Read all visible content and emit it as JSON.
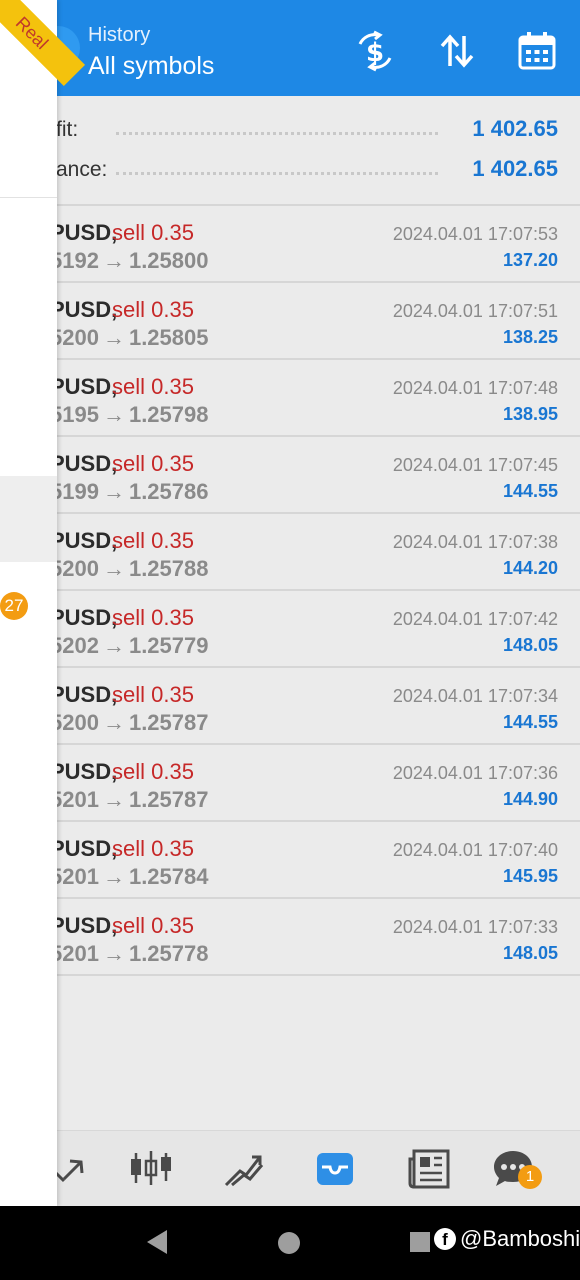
{
  "header": {
    "subtitle": "History",
    "title": "All symbols",
    "icons": [
      "currency-exchange-icon",
      "sort-icon",
      "calendar-icon"
    ]
  },
  "account_badge": "Real",
  "summary": {
    "profit_label": "fit:",
    "profit_value": "1 402.65",
    "balance_label": "ance:",
    "balance_value": "1 402.65"
  },
  "trades": [
    {
      "symbol": "PUSD,",
      "side": "sell 0.35",
      "open": "5192",
      "close": "1.25800",
      "time": "2024.04.01 17:07:53",
      "profit": "137.20"
    },
    {
      "symbol": "PUSD,",
      "side": "sell 0.35",
      "open": "5200",
      "close": "1.25805",
      "time": "2024.04.01 17:07:51",
      "profit": "138.25"
    },
    {
      "symbol": "PUSD,",
      "side": "sell 0.35",
      "open": "5195",
      "close": "1.25798",
      "time": "2024.04.01 17:07:48",
      "profit": "138.95"
    },
    {
      "symbol": "PUSD,",
      "side": "sell 0.35",
      "open": "5199",
      "close": "1.25786",
      "time": "2024.04.01 17:07:45",
      "profit": "144.55"
    },
    {
      "symbol": "PUSD,",
      "side": "sell 0.35",
      "open": "5200",
      "close": "1.25788",
      "time": "2024.04.01 17:07:38",
      "profit": "144.20"
    },
    {
      "symbol": "PUSD,",
      "side": "sell 0.35",
      "open": "5202",
      "close": "1.25779",
      "time": "2024.04.01 17:07:42",
      "profit": "148.05"
    },
    {
      "symbol": "PUSD,",
      "side": "sell 0.35",
      "open": "5200",
      "close": "1.25787",
      "time": "2024.04.01 17:07:34",
      "profit": "144.55"
    },
    {
      "symbol": "PUSD,",
      "side": "sell 0.35",
      "open": "5201",
      "close": "1.25787",
      "time": "2024.04.01 17:07:36",
      "profit": "144.90"
    },
    {
      "symbol": "PUSD,",
      "side": "sell 0.35",
      "open": "5201",
      "close": "1.25784",
      "time": "2024.04.01 17:07:40",
      "profit": "145.95"
    },
    {
      "symbol": "PUSD,",
      "side": "sell 0.35",
      "open": "5201",
      "close": "1.25778",
      "time": "2024.04.01 17:07:33",
      "profit": "148.05"
    }
  ],
  "drawer": {
    "badge": "27"
  },
  "bottom_nav": {
    "items": [
      "trade-icon",
      "candlestick-chart-icon",
      "trend-chart-icon",
      "history-inbox-icon",
      "news-icon",
      "chat-icon"
    ],
    "active": "history-inbox-icon",
    "chat_badge": "1"
  },
  "watermark": "@Bamboshi",
  "colors": {
    "header_blue": "#1e88e5",
    "value_blue": "#1976d2",
    "sell_red": "#c62828",
    "badge_orange": "#f39c12",
    "ribbon_yellow": "#f4c20d"
  }
}
